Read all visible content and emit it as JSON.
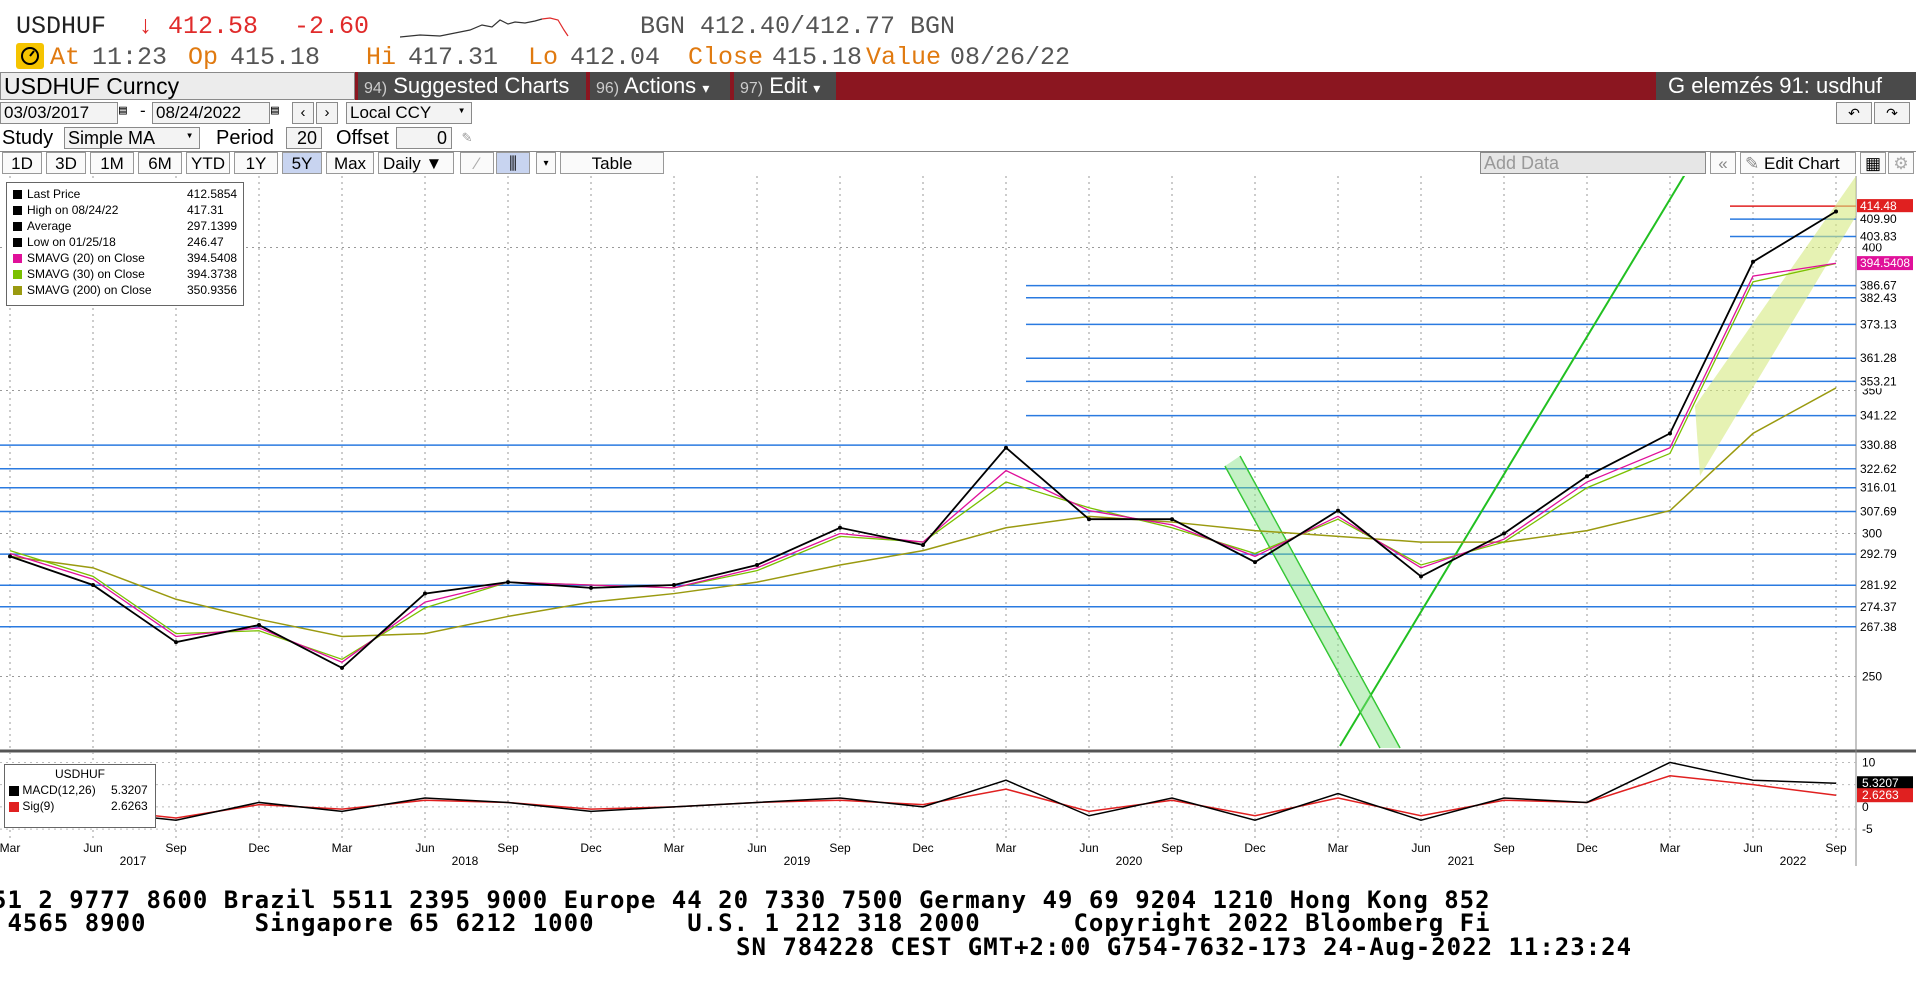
{
  "quote": {
    "ticker": "USDHUF",
    "last": "↓ 412.58",
    "change": "-2.60",
    "bid_ask": "BGN 412.40/412.77 BGN",
    "at_label": "At",
    "at_time": "11:23",
    "op_label": "Op",
    "op_value": "415.18",
    "hi_label": "Hi",
    "hi_value": "417.31",
    "lo_label": "Lo",
    "lo_value": "412.04",
    "close_label": "Close",
    "close_value": "415.18",
    "value_label": "Value",
    "value_date": "08/26/22"
  },
  "toolbar": {
    "security": "USDHUF Curncy",
    "suggested_num": "94)",
    "suggested": "Suggested Charts",
    "actions_num": "96)",
    "actions": "Actions",
    "edit_num": "97)",
    "edit": "Edit",
    "page_title": "G elemzés 91: usdhuf"
  },
  "date_row": {
    "start": "03/03/2017",
    "end": "08/24/2022",
    "currency": "Local CCY"
  },
  "study_row": {
    "study_label": "Study",
    "study_value": "Simple MA",
    "period_label": "Period",
    "period_value": "20",
    "offset_label": "Offset",
    "offset_value": "0"
  },
  "range_row": {
    "ranges": [
      "1D",
      "3D",
      "1M",
      "6M",
      "YTD",
      "1Y",
      "5Y",
      "Max"
    ],
    "selected": "5Y",
    "frequency": "Daily",
    "table": "Table",
    "add_data_placeholder": "Add Data",
    "edit_chart": "Edit Chart"
  },
  "legend": [
    {
      "label": "Last Price",
      "value": "412.5854",
      "color": "#000000"
    },
    {
      "label": "High on 08/24/22",
      "value": "417.31",
      "color": "#000000"
    },
    {
      "label": "Average",
      "value": "297.1399",
      "color": "#000000"
    },
    {
      "label": "Low on 01/25/18",
      "value": "246.47",
      "color": "#000000"
    },
    {
      "label": "SMAVG (20)  on Close",
      "value": "394.5408",
      "color": "#e0109a"
    },
    {
      "label": "SMAVG (30)  on Close",
      "value": "394.3738",
      "color": "#7ac000"
    },
    {
      "label": "SMAVG (200)  on Close",
      "value": "350.9356",
      "color": "#9a9a10"
    }
  ],
  "macd_legend": {
    "title": "USDHUF",
    "items": [
      {
        "label": "MACD(12,26)",
        "value": "5.3207",
        "color": "#000000"
      },
      {
        "label": "Sig(9)",
        "value": "2.6263",
        "color": "#e02020"
      }
    ]
  },
  "chart_data": [
    {
      "type": "line",
      "title": "",
      "y_tick_labels": [
        "250",
        "300",
        "350",
        "400"
      ],
      "ylim": [
        225,
        425
      ],
      "x_month_labels": [
        "Mar",
        "Jun",
        "Sep",
        "Dec",
        "Mar",
        "Jun",
        "Sep",
        "Dec",
        "Mar",
        "Jun",
        "Sep",
        "Dec",
        "Mar",
        "Jun",
        "Sep",
        "Dec",
        "Mar",
        "Jun",
        "Sep",
        "Dec",
        "Mar",
        "Jun",
        "Sep"
      ],
      "x_year_labels": [
        "2017",
        "2018",
        "2019",
        "2020",
        "2021",
        "2022"
      ],
      "grid": true,
      "legend_position": "top-left",
      "series": [
        {
          "name": "Last Price",
          "color": "#000000",
          "x": [
            "2017-03",
            "2017-06",
            "2017-09",
            "2017-12",
            "2018-03",
            "2018-06",
            "2018-09",
            "2018-12",
            "2019-03",
            "2019-06",
            "2019-09",
            "2019-12",
            "2020-03",
            "2020-06",
            "2020-09",
            "2020-12",
            "2021-03",
            "2021-06",
            "2021-09",
            "2021-12",
            "2022-03",
            "2022-06",
            "2022-08"
          ],
          "values": [
            292,
            282,
            262,
            268,
            253,
            279,
            283,
            281,
            282,
            289,
            302,
            296,
            330,
            305,
            305,
            290,
            308,
            285,
            300,
            320,
            335,
            395,
            412.6
          ]
        },
        {
          "name": "SMAVG (20)",
          "color": "#e0109a",
          "values": [
            293,
            284,
            264,
            267,
            255,
            276,
            283,
            282,
            281,
            288,
            300,
            297,
            322,
            308,
            303,
            292,
            306,
            288,
            298,
            318,
            330,
            390,
            394.5
          ]
        },
        {
          "name": "SMAVG (30)",
          "color": "#7ac000",
          "values": [
            294,
            285,
            265,
            266,
            256,
            274,
            283,
            282,
            281,
            287,
            299,
            297,
            318,
            309,
            302,
            293,
            305,
            289,
            297,
            316,
            328,
            388,
            394.4
          ]
        },
        {
          "name": "SMAVG (200)",
          "color": "#9a9a10",
          "values": [
            292,
            288,
            277,
            270,
            264,
            265,
            271,
            276,
            279,
            283,
            289,
            294,
            302,
            306,
            304,
            301,
            299,
            297,
            297,
            301,
            308,
            335,
            350.9
          ]
        }
      ],
      "price_levels": [
        "414.48",
        "409.90",
        "403.83",
        "394.5408",
        "386.67",
        "382.43",
        "373.13",
        "361.28",
        "353.21",
        "341.22",
        "330.88",
        "322.62",
        "316.01",
        "307.69",
        "292.79",
        "281.92",
        "274.37",
        "267.38"
      ],
      "highlight_levels": {
        "last": "414.48",
        "smavg20": "394.5408"
      }
    },
    {
      "type": "line",
      "title": "",
      "y_tick_labels": [
        "10",
        "5",
        "0",
        "-5"
      ],
      "ylim": [
        -7,
        11
      ],
      "series": [
        {
          "name": "MACD(12,26)",
          "color": "#000000",
          "values": [
            1,
            -1,
            -3,
            1,
            -1,
            2,
            1,
            -1,
            0,
            1,
            2,
            0,
            6,
            -2,
            2,
            -3,
            3,
            -3,
            2,
            1,
            10,
            6,
            5.3207
          ]
        },
        {
          "name": "Sig(9)",
          "color": "#e02020",
          "values": [
            1,
            -0.5,
            -2.5,
            0.5,
            -0.5,
            1.5,
            1,
            -0.5,
            0,
            1,
            1.5,
            0.5,
            4,
            -1,
            1.5,
            -2,
            2,
            -2,
            1.5,
            1,
            7,
            5,
            2.6263
          ]
        }
      ]
    }
  ],
  "footer": {
    "line1": "51 2 9777 8600 Brazil 5511 2395 9000 Europe 44 20 7330 7500 Germany 49 69 9204 1210 Hong Kong 852",
    "line2": " 4565 8900       Singapore 65 6212 1000      U.S. 1 212 318 2000      Copyright 2022 Bloomberg Fi",
    "line3": "SN 784228 CEST GMT+2:00 G754-7632-173 24-Aug-2022 11:23:24"
  }
}
